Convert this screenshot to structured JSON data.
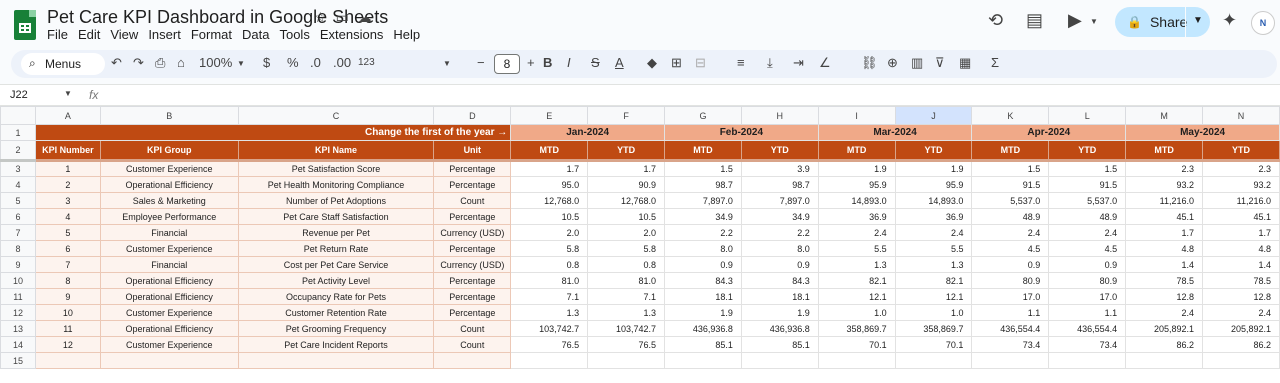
{
  "app": {
    "title": "Pet Care KPI Dashboard in Google Sheets",
    "menu": [
      "File",
      "Edit",
      "View",
      "Insert",
      "Format",
      "Data",
      "Tools",
      "Extensions",
      "Help"
    ],
    "share_label": "Share",
    "avatar_text": "N"
  },
  "toolbar": {
    "menus_label": "Menus",
    "zoom": "100%",
    "currency": "$",
    "percent": "%",
    "dec_decrease": ".0",
    "dec_increase": ".00",
    "num_format": "123",
    "font_size": "8"
  },
  "formula_bar": {
    "cell_ref": "J22",
    "fx": "fx",
    "value": ""
  },
  "columns": [
    "A",
    "B",
    "C",
    "D",
    "E",
    "F",
    "G",
    "H",
    "I",
    "J",
    "K",
    "L",
    "M",
    "N"
  ],
  "selected_column": "J",
  "row_numbers": [
    "1",
    "2",
    "3",
    "4",
    "5",
    "6",
    "7",
    "8",
    "9",
    "10",
    "11",
    "12",
    "13",
    "14",
    "15"
  ],
  "banner_text": "Change the first of the year →",
  "months": [
    "Jan-2024",
    "Feb-2024",
    "Mar-2024",
    "Apr-2024",
    "May-2024"
  ],
  "headers": [
    "KPI Number",
    "KPI Group",
    "KPI Name",
    "Unit",
    "MTD",
    "YTD",
    "MTD",
    "YTD",
    "MTD",
    "YTD",
    "MTD",
    "YTD",
    "MTD",
    "YTD"
  ],
  "rows": [
    [
      "1",
      "Customer Experience",
      "Pet Satisfaction Score",
      "Percentage",
      "1.7",
      "1.7",
      "1.5",
      "3.9",
      "1.9",
      "1.9",
      "1.5",
      "1.5",
      "2.3",
      "2.3"
    ],
    [
      "2",
      "Operational Efficiency",
      "Pet Health Monitoring Compliance",
      "Percentage",
      "95.0",
      "90.9",
      "98.7",
      "98.7",
      "95.9",
      "95.9",
      "91.5",
      "91.5",
      "93.2",
      "93.2"
    ],
    [
      "3",
      "Sales & Marketing",
      "Number of Pet Adoptions",
      "Count",
      "12,768.0",
      "12,768.0",
      "7,897.0",
      "7,897.0",
      "14,893.0",
      "14,893.0",
      "5,537.0",
      "5,537.0",
      "11,216.0",
      "11,216.0"
    ],
    [
      "4",
      "Employee Performance",
      "Pet Care Staff Satisfaction",
      "Percentage",
      "10.5",
      "10.5",
      "34.9",
      "34.9",
      "36.9",
      "36.9",
      "48.9",
      "48.9",
      "45.1",
      "45.1"
    ],
    [
      "5",
      "Financial",
      "Revenue per Pet",
      "Currency (USD)",
      "2.0",
      "2.0",
      "2.2",
      "2.2",
      "2.4",
      "2.4",
      "2.4",
      "2.4",
      "1.7",
      "1.7"
    ],
    [
      "6",
      "Customer Experience",
      "Pet Return Rate",
      "Percentage",
      "5.8",
      "5.8",
      "8.0",
      "8.0",
      "5.5",
      "5.5",
      "4.5",
      "4.5",
      "4.8",
      "4.8"
    ],
    [
      "7",
      "Financial",
      "Cost per Pet Care Service",
      "Currency (USD)",
      "0.8",
      "0.8",
      "0.9",
      "0.9",
      "1.3",
      "1.3",
      "0.9",
      "0.9",
      "1.4",
      "1.4"
    ],
    [
      "8",
      "Operational Efficiency",
      "Pet Activity Level",
      "Percentage",
      "81.0",
      "81.0",
      "84.3",
      "84.3",
      "82.1",
      "82.1",
      "80.9",
      "80.9",
      "78.5",
      "78.5"
    ],
    [
      "9",
      "Operational Efficiency",
      "Occupancy Rate for Pets",
      "Percentage",
      "7.1",
      "7.1",
      "18.1",
      "18.1",
      "12.1",
      "12.1",
      "17.0",
      "17.0",
      "12.8",
      "12.8"
    ],
    [
      "10",
      "Customer Experience",
      "Customer Retention Rate",
      "Percentage",
      "1.3",
      "1.3",
      "1.9",
      "1.9",
      "1.0",
      "1.0",
      "1.1",
      "1.1",
      "2.4",
      "2.4"
    ],
    [
      "11",
      "Operational Efficiency",
      "Pet Grooming Frequency",
      "Count",
      "103,742.7",
      "103,742.7",
      "436,936.8",
      "436,936.8",
      "358,869.7",
      "358,869.7",
      "436,554.4",
      "436,554.4",
      "205,892.1",
      "205,892.1"
    ],
    [
      "12",
      "Customer Experience",
      "Pet Care Incident Reports",
      "Count",
      "76.5",
      "76.5",
      "85.1",
      "85.1",
      "70.1",
      "70.1",
      "73.4",
      "73.4",
      "86.2",
      "86.2"
    ]
  ]
}
